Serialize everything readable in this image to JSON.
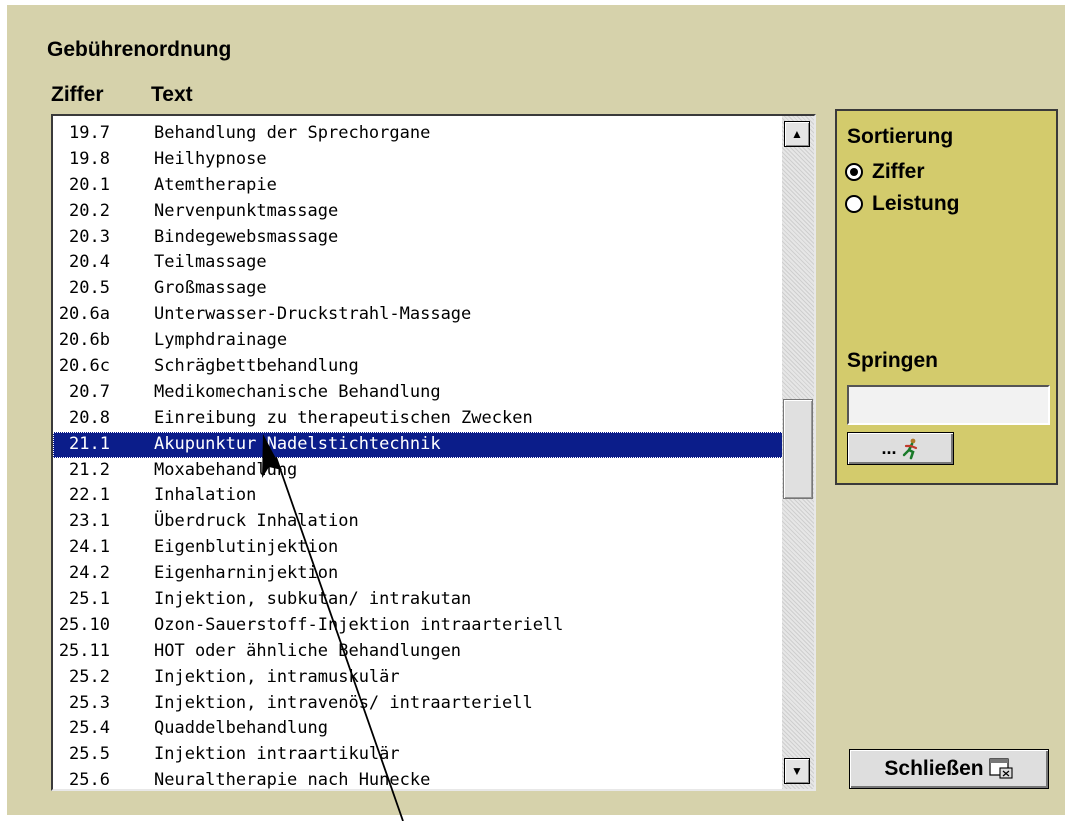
{
  "dialog": {
    "title": "Gebührenordnung",
    "columns": {
      "code": "Ziffer",
      "text": "Text"
    }
  },
  "list": {
    "rows": [
      {
        "code": "19.7",
        "text": "Behandlung der Sprechorgane"
      },
      {
        "code": "19.8",
        "text": "Heilhypnose"
      },
      {
        "code": "20.1",
        "text": "Atemtherapie"
      },
      {
        "code": "20.2",
        "text": "Nervenpunktmassage"
      },
      {
        "code": "20.3",
        "text": "Bindegewebsmassage"
      },
      {
        "code": "20.4",
        "text": "Teilmassage"
      },
      {
        "code": "20.5",
        "text": "Großmassage"
      },
      {
        "code": "20.6a",
        "text": "Unterwasser-Druckstrahl-Massage"
      },
      {
        "code": "20.6b",
        "text": "Lymphdrainage"
      },
      {
        "code": "20.6c",
        "text": "Schrägbettbehandlung"
      },
      {
        "code": "20.7",
        "text": "Medikomechanische Behandlung"
      },
      {
        "code": "20.8",
        "text": "Einreibung zu therapeutischen Zwecken"
      },
      {
        "code": "21.1",
        "text": "Akupunktur Nadelstichtechnik",
        "selected": true
      },
      {
        "code": "21.2",
        "text": "Moxabehandlung"
      },
      {
        "code": "22.1",
        "text": "Inhalation"
      },
      {
        "code": "23.1",
        "text": "Überdruck Inhalation"
      },
      {
        "code": "24.1",
        "text": "Eigenblutinjektion"
      },
      {
        "code": "24.2",
        "text": "Eigenharninjektion"
      },
      {
        "code": "25.1",
        "text": "Injektion, subkutan/ intrakutan"
      },
      {
        "code": "25.10",
        "text": "Ozon-Sauerstoff-Injektion intraarteriell"
      },
      {
        "code": "25.11",
        "text": "HOT oder ähnliche Behandlungen"
      },
      {
        "code": "25.2",
        "text": "Injektion, intramuskulär"
      },
      {
        "code": "25.3",
        "text": "Injektion, intravenös/ intraarteriell"
      },
      {
        "code": "25.4",
        "text": "Quaddelbehandlung"
      },
      {
        "code": "25.5",
        "text": "Injektion intraartikulär"
      },
      {
        "code": "25.6",
        "text": "Neuraltherapie nach Hunecke"
      }
    ],
    "selected_color": "#0b1d8a"
  },
  "sort_panel": {
    "label": "Sortierung",
    "options": [
      {
        "label": "Ziffer",
        "checked": true
      },
      {
        "label": "Leistung",
        "checked": false
      }
    ],
    "jump_label": "Springen",
    "jump_value": "",
    "jump_button_label": "...",
    "jump_button_icon": "running-man-icon",
    "background_color": "#d3cb6c"
  },
  "close_button": {
    "label": "Schließen",
    "icon": "window-close-icon"
  },
  "window_background": "#d6d2ab"
}
